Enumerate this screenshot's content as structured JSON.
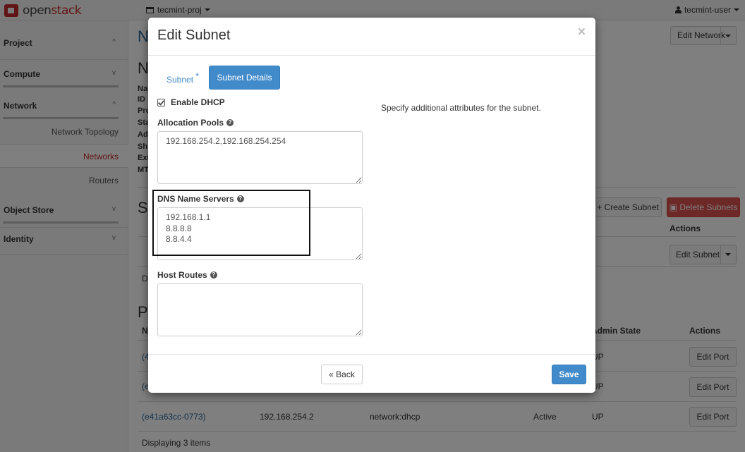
{
  "topbar": {
    "brand_prefix": "open",
    "brand_suffix": "stack",
    "project": "tecmint-proj",
    "user": "tecmint-user"
  },
  "sidebar": {
    "sections": [
      {
        "label": "Project",
        "chevron": "^"
      },
      {
        "label": "Compute",
        "chevron": "v"
      },
      {
        "label": "Network",
        "chevron": "^"
      },
      {
        "label": "Object Store",
        "chevron": "v"
      },
      {
        "label": "Identity",
        "chevron": "v"
      }
    ],
    "network_items": [
      {
        "label": "Network Topology",
        "active": false
      },
      {
        "label": "Networks",
        "active": true
      },
      {
        "label": "Routers",
        "active": false
      }
    ]
  },
  "page": {
    "title_fragment": "N",
    "overview_heading_fragment": "N",
    "overview_labels": [
      "Na",
      "ID",
      "Pro",
      "Sta",
      "Ad",
      "Sh",
      "Ext",
      "MT"
    ],
    "subnets_heading_fragment": "S",
    "ports_heading_fragment": "P",
    "edit_network_label": "Edit Network",
    "create_subnet_label": "+ Create Subnet",
    "delete_subnets_label": "Delete Subnets",
    "subnets_actions_header": "Actions",
    "edit_subnet_label": "Edit Subnet",
    "subnets_footer_fragment": "D",
    "ports_headers": {
      "name_fragment": "N",
      "admin_state": "Admin State",
      "actions": "Actions"
    },
    "ports_rows": [
      {
        "name": "(4",
        "fixed_ip": "",
        "attached": "",
        "status": "",
        "admin_state": "UP",
        "action": "Edit Port"
      },
      {
        "name": "(e",
        "fixed_ip": "",
        "attached": "",
        "status": "",
        "admin_state": "UP",
        "action": "Edit Port"
      },
      {
        "name": "(e41a63cc-0773)",
        "fixed_ip": "192.168.254.2",
        "attached": "network:dhcp",
        "status": "Active",
        "admin_state": "UP",
        "action": "Edit Port"
      }
    ],
    "ports_footer": "Displaying 3 items"
  },
  "modal": {
    "title": "Edit Subnet",
    "close_glyph": "×",
    "tabs": [
      {
        "label": "Subnet",
        "required_marker": "*",
        "active": false
      },
      {
        "label": "Subnet Details",
        "active": true
      }
    ],
    "enable_dhcp": {
      "label": "Enable DHCP",
      "checked": true
    },
    "allocation_pools": {
      "label": "Allocation Pools",
      "value": "192.168.254.2,192.168.254.254"
    },
    "dns_name_servers": {
      "label": "DNS Name Servers",
      "value": "192.168.1.1\n8.8.8.8\n8.8.4.4"
    },
    "host_routes": {
      "label": "Host Routes",
      "value": ""
    },
    "description": "Specify additional attributes for the subnet.",
    "back_label": "« Back",
    "save_label": "Save"
  },
  "colors": {
    "primary": "#428bca",
    "danger": "#d9534f",
    "brand_red": "#c52a2a",
    "link": "#2a6496"
  }
}
